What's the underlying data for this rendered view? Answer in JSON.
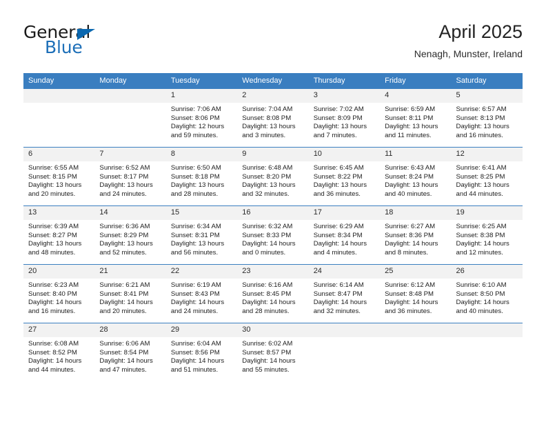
{
  "brand": {
    "line1": "General",
    "line2": "Blue",
    "flag_color": "#0b68b0",
    "text_color": "#1a1a1a",
    "accent_color": "#1d6fb8"
  },
  "header": {
    "title": "April 2025",
    "location": "Nenagh, Munster, Ireland"
  },
  "theme": {
    "header_bg": "#3a7ec0",
    "daynum_bg": "#f2f2f2",
    "border": "#3a7ec0"
  },
  "weekday_headers": [
    "Sunday",
    "Monday",
    "Tuesday",
    "Wednesday",
    "Thursday",
    "Friday",
    "Saturday"
  ],
  "weeks": [
    [
      {
        "day": "",
        "sunrise": "",
        "sunset": "",
        "daylight_line1": "",
        "daylight_line2": ""
      },
      {
        "day": "",
        "sunrise": "",
        "sunset": "",
        "daylight_line1": "",
        "daylight_line2": ""
      },
      {
        "day": "1",
        "sunrise": "Sunrise: 7:06 AM",
        "sunset": "Sunset: 8:06 PM",
        "daylight_line1": "Daylight: 12 hours",
        "daylight_line2": "and 59 minutes."
      },
      {
        "day": "2",
        "sunrise": "Sunrise: 7:04 AM",
        "sunset": "Sunset: 8:08 PM",
        "daylight_line1": "Daylight: 13 hours",
        "daylight_line2": "and 3 minutes."
      },
      {
        "day": "3",
        "sunrise": "Sunrise: 7:02 AM",
        "sunset": "Sunset: 8:09 PM",
        "daylight_line1": "Daylight: 13 hours",
        "daylight_line2": "and 7 minutes."
      },
      {
        "day": "4",
        "sunrise": "Sunrise: 6:59 AM",
        "sunset": "Sunset: 8:11 PM",
        "daylight_line1": "Daylight: 13 hours",
        "daylight_line2": "and 11 minutes."
      },
      {
        "day": "5",
        "sunrise": "Sunrise: 6:57 AM",
        "sunset": "Sunset: 8:13 PM",
        "daylight_line1": "Daylight: 13 hours",
        "daylight_line2": "and 16 minutes."
      }
    ],
    [
      {
        "day": "6",
        "sunrise": "Sunrise: 6:55 AM",
        "sunset": "Sunset: 8:15 PM",
        "daylight_line1": "Daylight: 13 hours",
        "daylight_line2": "and 20 minutes."
      },
      {
        "day": "7",
        "sunrise": "Sunrise: 6:52 AM",
        "sunset": "Sunset: 8:17 PM",
        "daylight_line1": "Daylight: 13 hours",
        "daylight_line2": "and 24 minutes."
      },
      {
        "day": "8",
        "sunrise": "Sunrise: 6:50 AM",
        "sunset": "Sunset: 8:18 PM",
        "daylight_line1": "Daylight: 13 hours",
        "daylight_line2": "and 28 minutes."
      },
      {
        "day": "9",
        "sunrise": "Sunrise: 6:48 AM",
        "sunset": "Sunset: 8:20 PM",
        "daylight_line1": "Daylight: 13 hours",
        "daylight_line2": "and 32 minutes."
      },
      {
        "day": "10",
        "sunrise": "Sunrise: 6:45 AM",
        "sunset": "Sunset: 8:22 PM",
        "daylight_line1": "Daylight: 13 hours",
        "daylight_line2": "and 36 minutes."
      },
      {
        "day": "11",
        "sunrise": "Sunrise: 6:43 AM",
        "sunset": "Sunset: 8:24 PM",
        "daylight_line1": "Daylight: 13 hours",
        "daylight_line2": "and 40 minutes."
      },
      {
        "day": "12",
        "sunrise": "Sunrise: 6:41 AM",
        "sunset": "Sunset: 8:25 PM",
        "daylight_line1": "Daylight: 13 hours",
        "daylight_line2": "and 44 minutes."
      }
    ],
    [
      {
        "day": "13",
        "sunrise": "Sunrise: 6:39 AM",
        "sunset": "Sunset: 8:27 PM",
        "daylight_line1": "Daylight: 13 hours",
        "daylight_line2": "and 48 minutes."
      },
      {
        "day": "14",
        "sunrise": "Sunrise: 6:36 AM",
        "sunset": "Sunset: 8:29 PM",
        "daylight_line1": "Daylight: 13 hours",
        "daylight_line2": "and 52 minutes."
      },
      {
        "day": "15",
        "sunrise": "Sunrise: 6:34 AM",
        "sunset": "Sunset: 8:31 PM",
        "daylight_line1": "Daylight: 13 hours",
        "daylight_line2": "and 56 minutes."
      },
      {
        "day": "16",
        "sunrise": "Sunrise: 6:32 AM",
        "sunset": "Sunset: 8:33 PM",
        "daylight_line1": "Daylight: 14 hours",
        "daylight_line2": "and 0 minutes."
      },
      {
        "day": "17",
        "sunrise": "Sunrise: 6:29 AM",
        "sunset": "Sunset: 8:34 PM",
        "daylight_line1": "Daylight: 14 hours",
        "daylight_line2": "and 4 minutes."
      },
      {
        "day": "18",
        "sunrise": "Sunrise: 6:27 AM",
        "sunset": "Sunset: 8:36 PM",
        "daylight_line1": "Daylight: 14 hours",
        "daylight_line2": "and 8 minutes."
      },
      {
        "day": "19",
        "sunrise": "Sunrise: 6:25 AM",
        "sunset": "Sunset: 8:38 PM",
        "daylight_line1": "Daylight: 14 hours",
        "daylight_line2": "and 12 minutes."
      }
    ],
    [
      {
        "day": "20",
        "sunrise": "Sunrise: 6:23 AM",
        "sunset": "Sunset: 8:40 PM",
        "daylight_line1": "Daylight: 14 hours",
        "daylight_line2": "and 16 minutes."
      },
      {
        "day": "21",
        "sunrise": "Sunrise: 6:21 AM",
        "sunset": "Sunset: 8:41 PM",
        "daylight_line1": "Daylight: 14 hours",
        "daylight_line2": "and 20 minutes."
      },
      {
        "day": "22",
        "sunrise": "Sunrise: 6:19 AM",
        "sunset": "Sunset: 8:43 PM",
        "daylight_line1": "Daylight: 14 hours",
        "daylight_line2": "and 24 minutes."
      },
      {
        "day": "23",
        "sunrise": "Sunrise: 6:16 AM",
        "sunset": "Sunset: 8:45 PM",
        "daylight_line1": "Daylight: 14 hours",
        "daylight_line2": "and 28 minutes."
      },
      {
        "day": "24",
        "sunrise": "Sunrise: 6:14 AM",
        "sunset": "Sunset: 8:47 PM",
        "daylight_line1": "Daylight: 14 hours",
        "daylight_line2": "and 32 minutes."
      },
      {
        "day": "25",
        "sunrise": "Sunrise: 6:12 AM",
        "sunset": "Sunset: 8:48 PM",
        "daylight_line1": "Daylight: 14 hours",
        "daylight_line2": "and 36 minutes."
      },
      {
        "day": "26",
        "sunrise": "Sunrise: 6:10 AM",
        "sunset": "Sunset: 8:50 PM",
        "daylight_line1": "Daylight: 14 hours",
        "daylight_line2": "and 40 minutes."
      }
    ],
    [
      {
        "day": "27",
        "sunrise": "Sunrise: 6:08 AM",
        "sunset": "Sunset: 8:52 PM",
        "daylight_line1": "Daylight: 14 hours",
        "daylight_line2": "and 44 minutes."
      },
      {
        "day": "28",
        "sunrise": "Sunrise: 6:06 AM",
        "sunset": "Sunset: 8:54 PM",
        "daylight_line1": "Daylight: 14 hours",
        "daylight_line2": "and 47 minutes."
      },
      {
        "day": "29",
        "sunrise": "Sunrise: 6:04 AM",
        "sunset": "Sunset: 8:56 PM",
        "daylight_line1": "Daylight: 14 hours",
        "daylight_line2": "and 51 minutes."
      },
      {
        "day": "30",
        "sunrise": "Sunrise: 6:02 AM",
        "sunset": "Sunset: 8:57 PM",
        "daylight_line1": "Daylight: 14 hours",
        "daylight_line2": "and 55 minutes."
      },
      {
        "day": "",
        "sunrise": "",
        "sunset": "",
        "daylight_line1": "",
        "daylight_line2": ""
      },
      {
        "day": "",
        "sunrise": "",
        "sunset": "",
        "daylight_line1": "",
        "daylight_line2": ""
      },
      {
        "day": "",
        "sunrise": "",
        "sunset": "",
        "daylight_line1": "",
        "daylight_line2": ""
      }
    ]
  ]
}
